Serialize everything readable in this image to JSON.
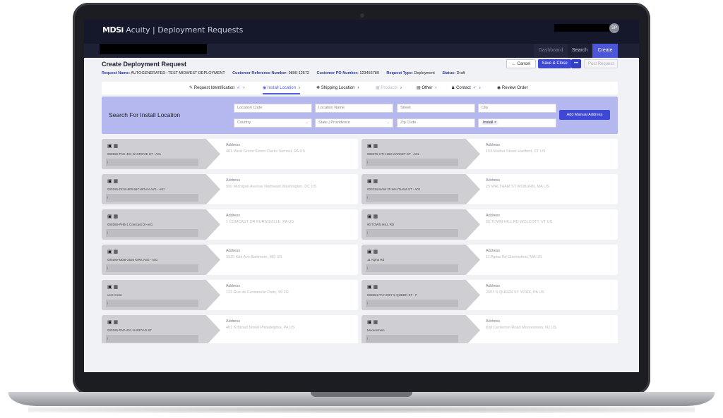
{
  "app": {
    "brand_mark": "MDSi",
    "title": "Acuity | Deployment Requests",
    "avatar_initials": "SP"
  },
  "nav": {
    "dashboard": "Dashboard",
    "search": "Search",
    "create": "Create"
  },
  "page": {
    "title": "Create Deployment Request",
    "meta": [
      {
        "key": "Request Name:",
        "value": "AUTOGENERATED--TEST MIDWEST DEPLOYMENT"
      },
      {
        "key": "Customer Reference Number:",
        "value": "9800-12572"
      },
      {
        "key": "Customer PO Number:",
        "value": "123456789"
      },
      {
        "key": "Request Type:",
        "value": "Deployment"
      },
      {
        "key": "Status:",
        "value": "Draft"
      }
    ]
  },
  "actions": {
    "cancel": "Cancel",
    "save_close": "Save & Close",
    "more": "•••",
    "post": "Post Request"
  },
  "steps": [
    {
      "label": "Request Identification",
      "icon": "edit-icon",
      "state": "done"
    },
    {
      "label": "Install Location",
      "icon": "pin-icon",
      "state": "active"
    },
    {
      "label": "Shipping Location",
      "icon": "move-icon",
      "state": "normal"
    },
    {
      "label": "Products",
      "icon": "box-icon",
      "state": "disabled"
    },
    {
      "label": "Other",
      "icon": "file-icon",
      "state": "normal"
    },
    {
      "label": "Contact",
      "icon": "person-icon",
      "state": "done"
    },
    {
      "label": "Review Order",
      "icon": "eye-icon",
      "state": "normal"
    }
  ],
  "search": {
    "title": "Search For Install Location",
    "location_code": "Location Code",
    "location_name": "Location Name",
    "street": "Street",
    "city": "City",
    "country": "Country",
    "state": "State | Providence",
    "zip": "Zip Code",
    "type_tag": "Install",
    "add_manual": "Add Manual Address"
  },
  "cards": [
    {
      "code": "000159-PAC-401 W GROVE ST - A01",
      "label": "Address",
      "addr": "401 West Grove Street Clarks Summit, PA US"
    },
    {
      "code": "000376-CTH-153 MARKET ST - A01",
      "label": "Address",
      "addr": "153 Market Street Hartford, CT US"
    },
    {
      "code": "000165-DCW-900 MICHIGAN AVE - A01",
      "label": "Address",
      "addr": "900 Michigan Avenue Northeast Washington, DC US"
    },
    {
      "code": "000234 MAW 25 WALTHAM ST - A01",
      "label": "Address",
      "addr": "25 WALTHAM ST WOBURN, MA US"
    },
    {
      "code": "000168-PHB-1 Comcast Dr-A01",
      "label": "Address",
      "addr": "1 COMCAST DR BURNSVILLE, PA US"
    },
    {
      "code": "90 TOWN HILL RD",
      "label": "Address",
      "addr": "90 TOWN HILL RD WOLCOTT, VT US"
    },
    {
      "code": "000169-MDB-2525 KIRK AVE - A01",
      "label": "Address",
      "addr": "2525 Kirk Ave Baltimore, MD US"
    },
    {
      "code": "11 Alpha Rd",
      "label": "Address",
      "addr": "11 Alpha Rd Chelmsford, MA US"
    },
    {
      "code": "ust HI test",
      "label": "Address",
      "addr": "123 Rue de Funkanelle Paris, 99 FR"
    },
    {
      "code": "000654 PAY 2007 S QUEEN ST - F",
      "label": "Address",
      "addr": "2007 S QUEEN ST YORK, PA US"
    },
    {
      "code": "000185-PAP-401 N BROAD ST",
      "label": "Address",
      "addr": "401 N Broad Street Philadelphia, PA US"
    },
    {
      "code": "Moorestown",
      "label": "Address",
      "addr": "838 Centerton Road Moorestown, NJ US"
    }
  ]
}
